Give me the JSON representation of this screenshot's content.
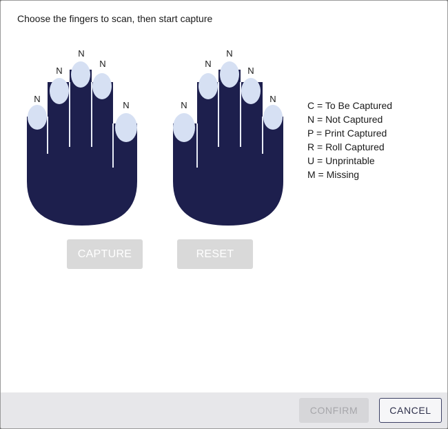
{
  "instruction": "Choose the fingers to scan, then start capture",
  "colors": {
    "hand": "#1d1f4d",
    "fingertip": "#d6e0f3",
    "button_disabled": "#d9d9d9"
  },
  "left_hand": {
    "finger_labels": [
      "N",
      "N",
      "N",
      "N",
      "N"
    ]
  },
  "right_hand": {
    "finger_labels": [
      "N",
      "N",
      "N",
      "N",
      "N"
    ]
  },
  "legend": [
    "C = To Be Captured",
    "N = Not Captured",
    "P = Print Captured",
    "R = Roll Captured",
    "U = Unprintable",
    "M = Missing"
  ],
  "buttons": {
    "capture": "CAPTURE",
    "reset": "RESET",
    "confirm": "CONFIRM",
    "cancel": "CANCEL"
  }
}
